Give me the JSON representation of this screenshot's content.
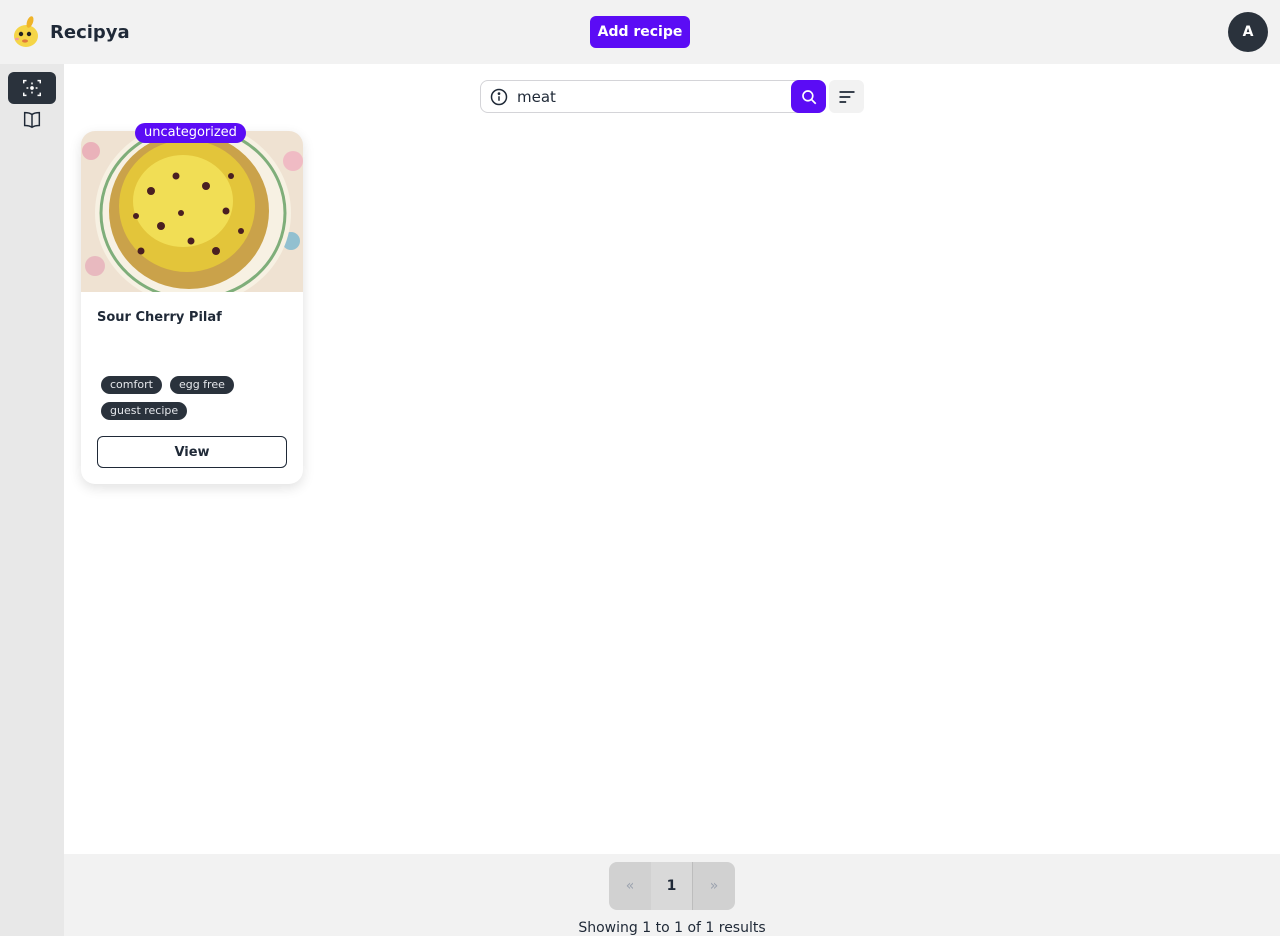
{
  "header": {
    "brand_name": "Recipya",
    "add_recipe_label": "Add recipe",
    "avatar_initial": "A"
  },
  "sidebar": {
    "items": [
      {
        "icon": "recipes-scan-icon",
        "active": true
      },
      {
        "icon": "cookbook-icon",
        "active": false
      }
    ]
  },
  "search": {
    "value": "meat",
    "placeholder": ""
  },
  "recipes": [
    {
      "category": "uncategorized",
      "title": "Sour Cherry Pilaf",
      "tags": [
        "comfort",
        "egg free",
        "guest recipe"
      ],
      "view_label": "View"
    }
  ],
  "pagination": {
    "prev": "«",
    "current": "1",
    "next": "»",
    "summary": "Showing 1 to 1 of 1 results"
  },
  "colors": {
    "accent": "#5b0cf5",
    "dark": "#2a323c"
  }
}
